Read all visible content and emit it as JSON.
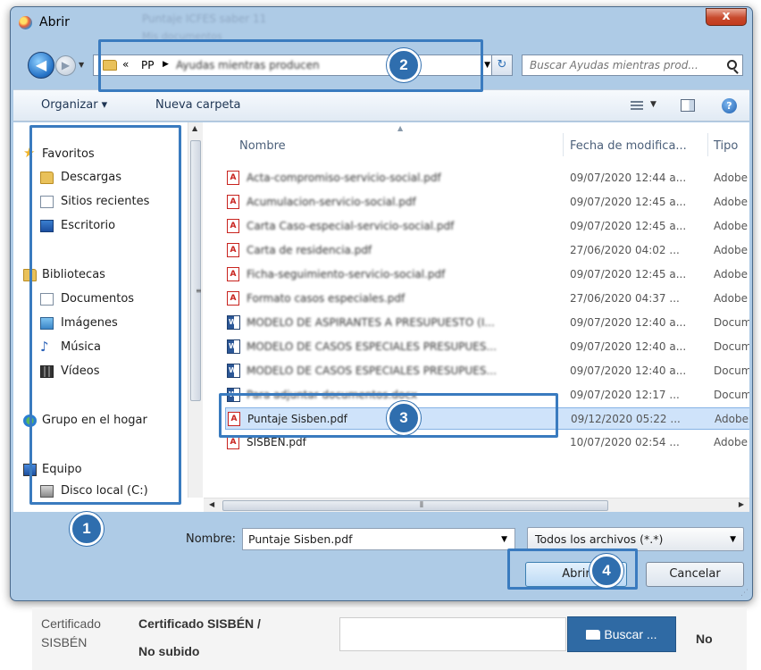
{
  "window": {
    "title": "Abrir",
    "close_label": "x",
    "ghost_title": "Puntaje ICFES saber 11",
    "ghost_subtitle": "Mis documentos"
  },
  "address": {
    "chevron": "«",
    "root": "PP",
    "current": "Ayudas mientras producen",
    "refresh": "↻"
  },
  "search": {
    "placeholder": "Buscar Ayudas mientras prod..."
  },
  "toolbar": {
    "organizar": "Organizar ▾",
    "nueva_carpeta": "Nueva carpeta",
    "help": "?"
  },
  "sidebar": {
    "favoritos": "Favoritos",
    "descargas": "Descargas",
    "sitios_recientes": "Sitios recientes",
    "escritorio": "Escritorio",
    "bibliotecas": "Bibliotecas",
    "documentos": "Documentos",
    "imagenes": "Imágenes",
    "musica": "Música",
    "videos": "Vídeos",
    "grupo_hogar": "Grupo en el hogar",
    "equipo": "Equipo",
    "disco_local": "Disco local (C:)"
  },
  "columns": {
    "name": "Nombre",
    "date": "Fecha de modifica...",
    "type": "Tipo"
  },
  "files": [
    {
      "name": "Acta-compromiso-servicio-social.pdf",
      "date": "09/07/2020 12:44 a...",
      "type": "Adobe A"
    },
    {
      "name": "Acumulacion-servicio-social.pdf",
      "date": "09/07/2020 12:45 a...",
      "type": "Adobe A"
    },
    {
      "name": "Carta Caso-especial-servicio-social.pdf",
      "date": "09/07/2020 12:45 a...",
      "type": "Adobe A"
    },
    {
      "name": "Carta de residencia.pdf",
      "date": "27/06/2020 04:02 ...",
      "type": "Adobe A"
    },
    {
      "name": "Ficha-seguimiento-servicio-social.pdf",
      "date": "09/07/2020 12:45 a...",
      "type": "Adobe A"
    },
    {
      "name": "Formato casos especiales.pdf",
      "date": "27/06/2020 04:37 ...",
      "type": "Adobe A"
    },
    {
      "name": "MODELO DE ASPIRANTES A PRESUPUESTO (I...",
      "date": "09/07/2020 12:40 a...",
      "type": "Docume"
    },
    {
      "name": "MODELO DE CASOS ESPECIALES PRESUPUES...",
      "date": "09/07/2020 12:40 a...",
      "type": "Docume"
    },
    {
      "name": "MODELO DE CASOS ESPECIALES PRESUPUES...",
      "date": "09/07/2020 12:40 a...",
      "type": "Docume"
    },
    {
      "name": "Para adjuntar documentos.docx",
      "date": "09/07/2020 12:17 ...",
      "type": "Docume"
    },
    {
      "name": "Puntaje Sisben.pdf",
      "date": "09/12/2020 05:22 ...",
      "type": "Adobe A"
    },
    {
      "name": "SISBEN.pdf",
      "date": "10/07/2020 02:54 ...",
      "type": "Adobe A"
    }
  ],
  "bottom": {
    "nombre_label": "Nombre:",
    "nombre_value": "Puntaje Sisben.pdf",
    "filter_value": "Todos los archivos (*.*)",
    "open_button": "Abrir",
    "cancel_button": "Cancelar"
  },
  "badges": [
    "1",
    "2",
    "3",
    "4"
  ],
  "page_below": {
    "certificado": "Certificado",
    "sisben": "SISBÉN",
    "cert_title": "Certificado SISBÉN /",
    "no_subido": "No subido",
    "buscar": "Buscar ...",
    "no": "No"
  },
  "colors": {
    "annotation": "#3a7bbf",
    "badge": "#2f6eae",
    "selected_row": "#cfe3fa"
  }
}
